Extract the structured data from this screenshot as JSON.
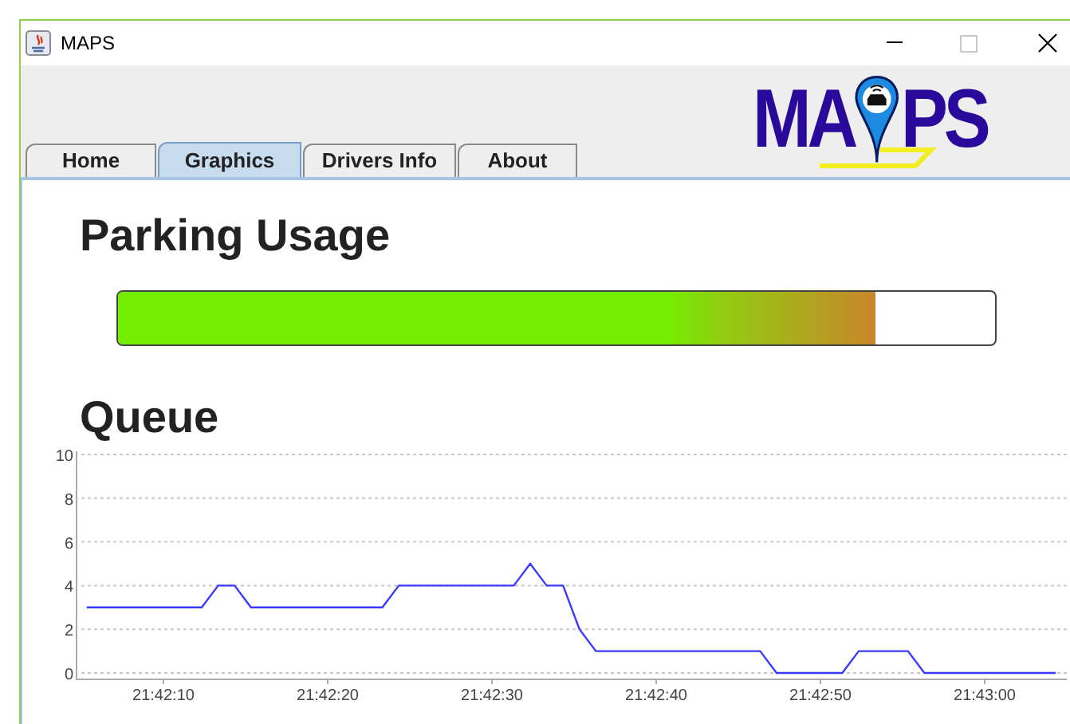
{
  "window": {
    "title": "MAPS"
  },
  "logo": {
    "left": "MA",
    "right": "PS"
  },
  "tabs": [
    {
      "label": "Home",
      "selected": false
    },
    {
      "label": "Graphics",
      "selected": true
    },
    {
      "label": "Drivers Info",
      "selected": false
    },
    {
      "label": "About",
      "selected": false
    }
  ],
  "parking": {
    "title": "Parking Usage",
    "level": 0.864
  },
  "queue": {
    "chart_data": {
      "type": "line",
      "title": "Queue",
      "categories": [
        null,
        null,
        null,
        null,
        null,
        "21:42:10",
        null,
        null,
        null,
        null,
        null,
        null,
        null,
        null,
        null,
        "21:42:20",
        null,
        null,
        null,
        null,
        null,
        null,
        null,
        null,
        null,
        "21:42:30",
        null,
        null,
        null,
        null,
        null,
        null,
        null,
        null,
        null,
        "21:42:40",
        null,
        null,
        null,
        null,
        null,
        null,
        null,
        null,
        null,
        "21:42:50",
        null,
        null,
        null,
        null,
        null,
        null,
        null,
        null,
        null,
        "21:43:00",
        null,
        null,
        null,
        null
      ],
      "series": [
        {
          "color": "#3a3aff",
          "values": [
            3,
            3,
            3,
            3,
            3,
            3,
            3,
            3,
            4,
            4,
            3,
            3,
            3,
            3,
            3,
            3,
            3,
            3,
            3,
            4,
            4,
            4,
            4,
            4,
            4,
            4,
            4,
            5,
            4,
            4,
            2,
            1,
            1,
            1,
            1,
            1,
            1,
            1,
            1,
            1,
            1,
            1,
            0,
            0,
            0,
            0,
            0,
            1,
            1,
            1,
            1,
            0,
            0,
            0,
            0,
            0,
            0,
            0,
            0,
            0
          ]
        }
      ],
      "ylim": [
        0,
        10
      ],
      "yticks": [
        0,
        2,
        4,
        6,
        8,
        10
      ],
      "grid": true
    }
  }
}
